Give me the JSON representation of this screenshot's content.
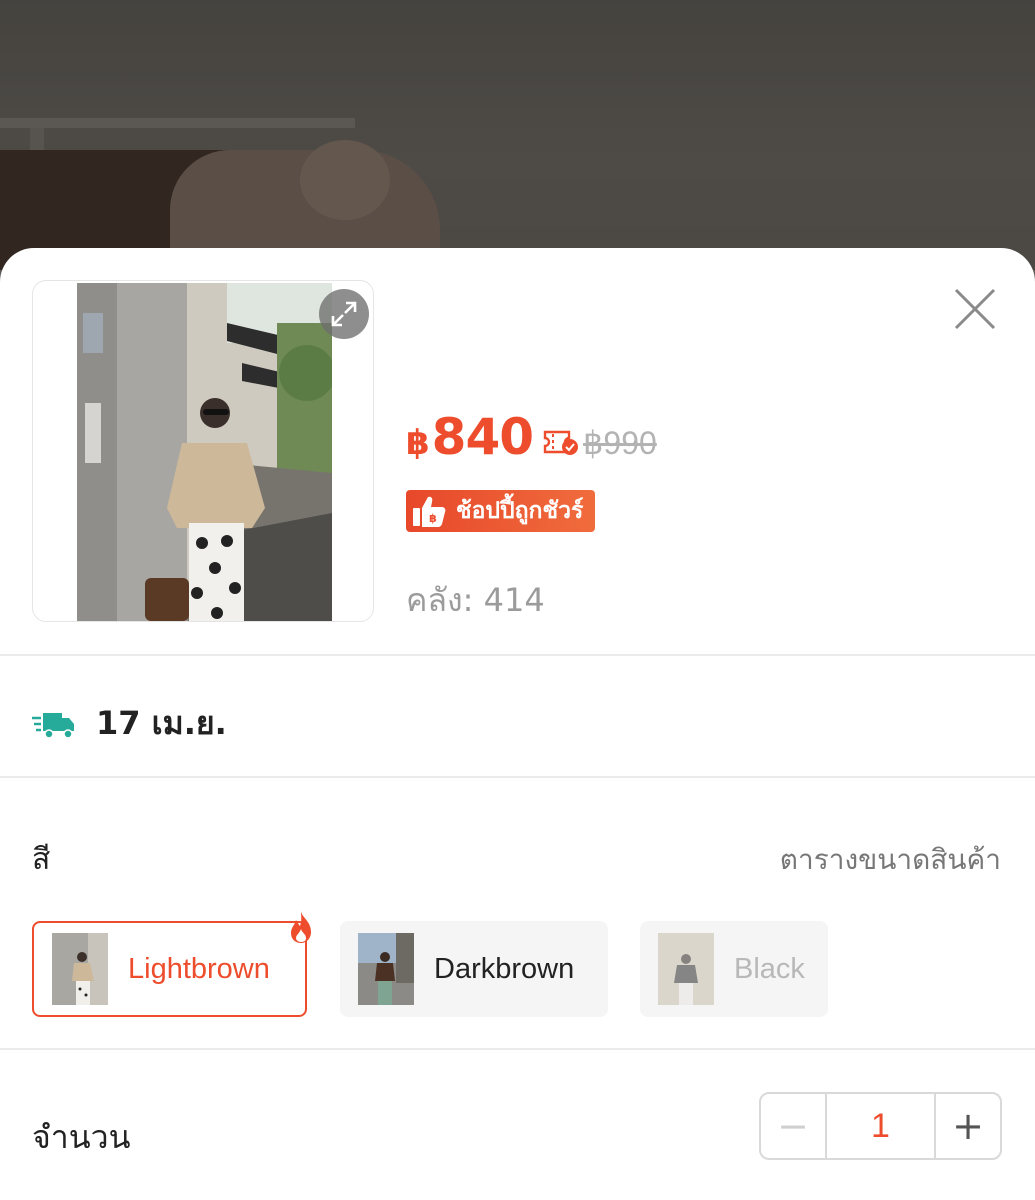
{
  "product": {
    "price_currency": "฿",
    "price": "840",
    "original_price": "฿990",
    "badge_text": "ช้อปปี้ถูกชัวร์",
    "stock_text": "คลัง: 414"
  },
  "delivery": {
    "date_text": "17 เม.ย."
  },
  "variation": {
    "label": "สี",
    "size_chart_link": "ตารางขนาดสินค้า",
    "options": [
      {
        "label": "Lightbrown",
        "state": "selected"
      },
      {
        "label": "Darkbrown",
        "state": "available"
      },
      {
        "label": "Black",
        "state": "disabled"
      }
    ]
  },
  "quantity": {
    "label": "จำนวน",
    "minus": "−",
    "value": "1",
    "plus": "+"
  },
  "icons": {
    "expand": "expand-icon",
    "close": "close-icon",
    "coupon": "coupon-icon",
    "badge": "thumbs-up-baht-icon",
    "truck": "fast-delivery-truck-icon",
    "hot": "flame-icon"
  },
  "colors": {
    "accent": "#ee4d2d",
    "delivery_icon": "#26aa99"
  }
}
